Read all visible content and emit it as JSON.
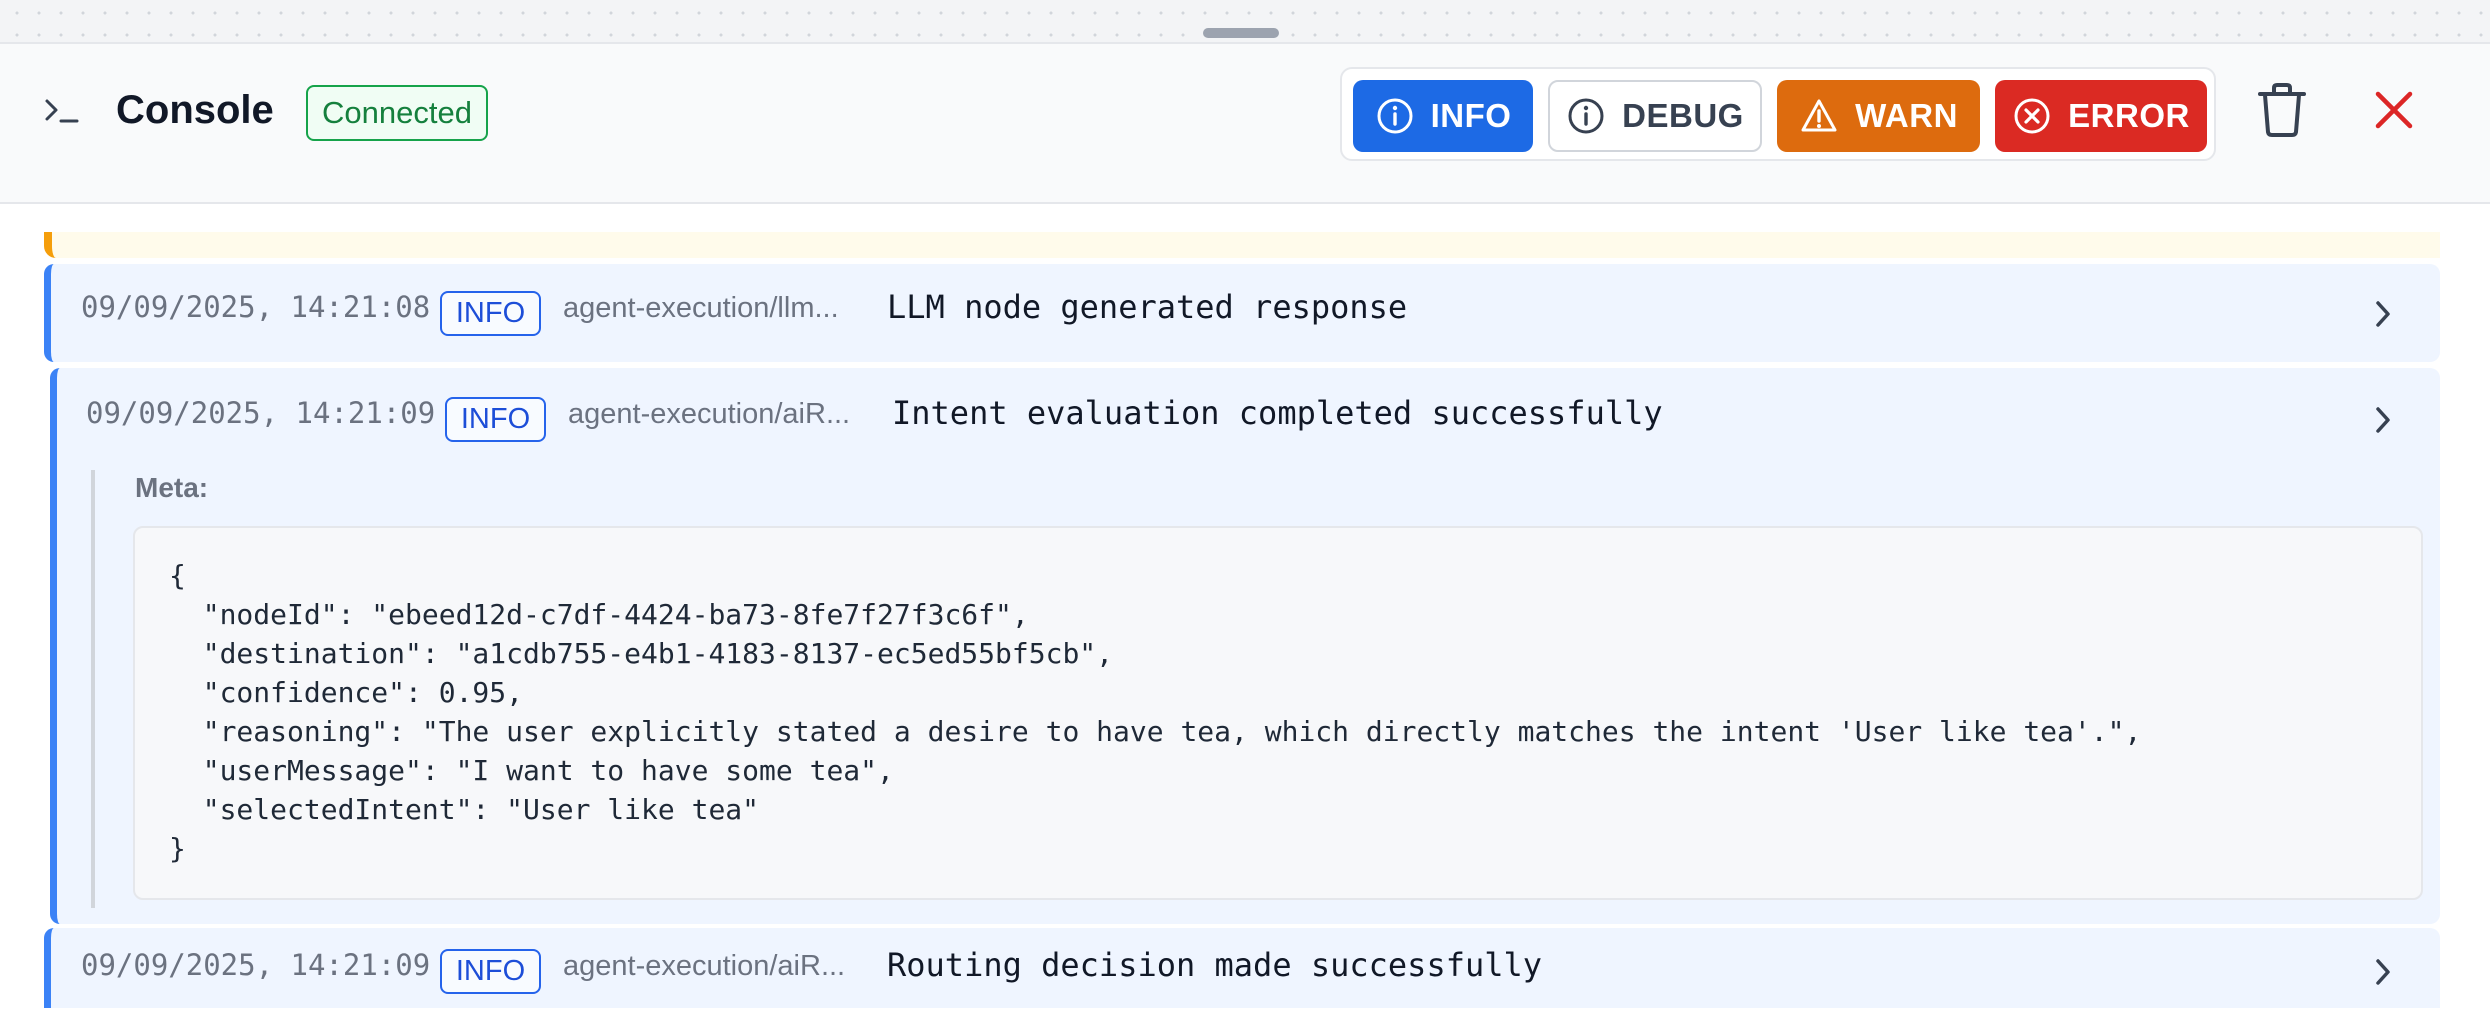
{
  "console": {
    "title": "Console",
    "status": "Connected",
    "filters": [
      {
        "label": "INFO",
        "icon": "info-circle-icon",
        "active": true,
        "color": "#1d6ae5"
      },
      {
        "label": "DEBUG",
        "icon": "info-circle-icon",
        "active": false,
        "color": "#ffffff"
      },
      {
        "label": "WARN",
        "icon": "warning-triangle-icon",
        "active": true,
        "color": "#dd6b0e"
      },
      {
        "label": "ERROR",
        "icon": "x-circle-icon",
        "active": true,
        "color": "#db2a23"
      }
    ],
    "actions": {
      "clear_icon": "trash-icon",
      "close_icon": "close-icon"
    }
  },
  "logs": [
    {
      "timestamp": "09/09/2025, 14:21:08",
      "level": "INFO",
      "source": "agent-execution/llm...",
      "message": "LLM node generated response",
      "expanded": false
    },
    {
      "timestamp": "09/09/2025, 14:21:09",
      "level": "INFO",
      "source": "agent-execution/aiR...",
      "message": "Intent evaluation completed successfully",
      "expanded": true,
      "meta_label": "Meta:",
      "meta": "{\n  \"nodeId\": \"ebeed12d-c7df-4424-ba73-8fe7f27f3c6f\",\n  \"destination\": \"a1cdb755-e4b1-4183-8137-ec5ed55bf5cb\",\n  \"confidence\": 0.95,\n  \"reasoning\": \"The user explicitly stated a desire to have tea, which directly matches the intent 'User like tea'.\",\n  \"userMessage\": \"I want to have some tea\",\n  \"selectedIntent\": \"User like tea\"\n}"
    },
    {
      "timestamp": "09/09/2025, 14:21:09",
      "level": "INFO",
      "source": "agent-execution/aiR...",
      "message": "Routing decision made successfully",
      "expanded": false
    }
  ],
  "colors": {
    "info_accent": "#3b82f6",
    "warn_accent": "#f59e0b",
    "connected": "#16a34a"
  }
}
